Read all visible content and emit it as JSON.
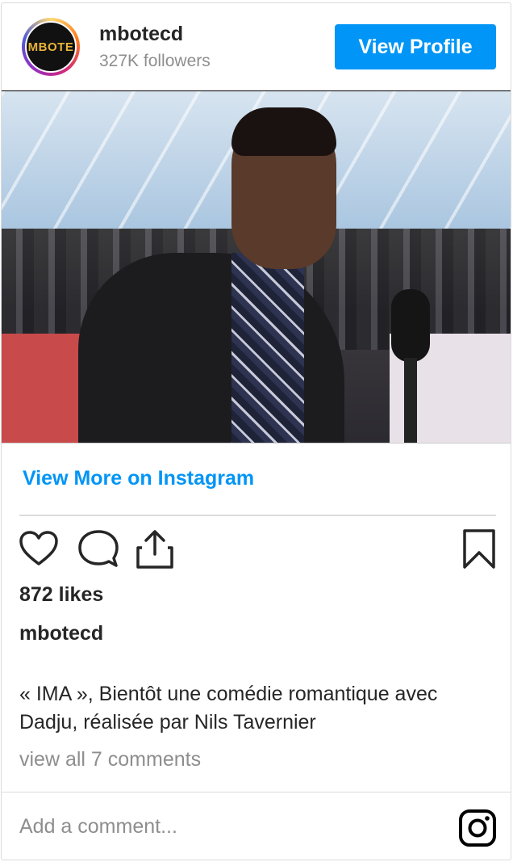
{
  "header": {
    "avatar_text": "MBOTE",
    "username": "mbotecd",
    "followers": "327K followers",
    "view_profile_label": "View Profile"
  },
  "media": {
    "icon": "video-still-image"
  },
  "view_more_label": "View More on Instagram",
  "actions": {
    "like_icon": "heart-icon",
    "comment_icon": "comment-icon",
    "share_icon": "share-icon",
    "save_icon": "bookmark-icon"
  },
  "likes": "872 likes",
  "caption": {
    "username": "mbotecd",
    "text": "« IMA », Bientôt une comédie romantique avec Dadju, réalisée par Nils Tavernier"
  },
  "comments_link": "view all 7 comments",
  "add_comment_placeholder": "Add a comment...",
  "colors": {
    "accent": "#0095f6",
    "text": "#262626",
    "muted": "#8e8e8e"
  }
}
